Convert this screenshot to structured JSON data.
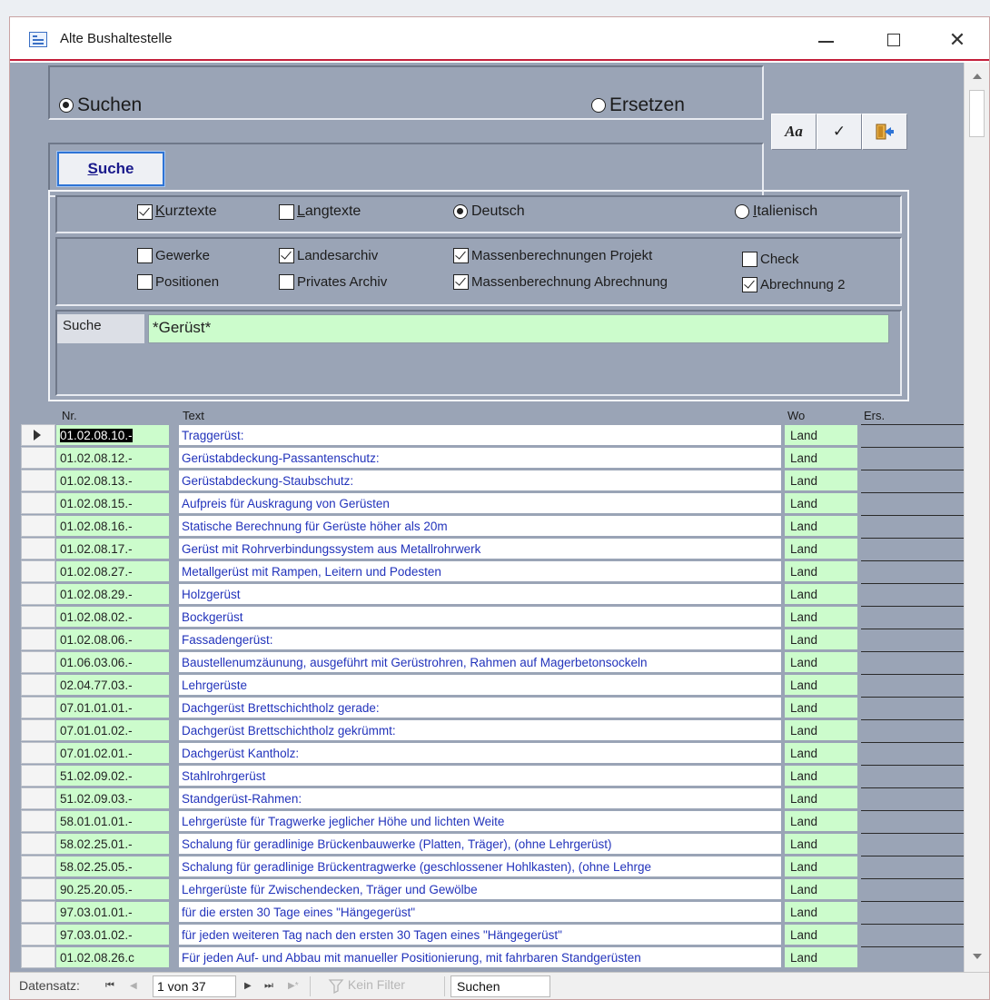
{
  "window": {
    "title": "Alte Bushaltestelle",
    "close_symbol": "✕"
  },
  "mode": {
    "search_label": "Suchen",
    "replace_label": "Ersetzen",
    "selected": "Suchen"
  },
  "toolbar": {
    "font_label": "Aa",
    "check_label": "✓"
  },
  "search_button_label": "Suche",
  "text_type": {
    "short_label": "Kurztexte",
    "short_checked": true,
    "long_label": "Langtexte",
    "long_checked": false,
    "german_label": "Deutsch",
    "italian_label": "Italienisch",
    "language_selected": "Deutsch"
  },
  "sources": {
    "gewerke": "Gewerke",
    "positionen": "Positionen",
    "landesarchiv": "Landesarchiv",
    "privates_archiv": "Privates Archiv",
    "mb_projekt": "Massenberechnungen Projekt",
    "mb_abrechnung": "Massenberechnung Abrechnung",
    "check": "Check",
    "abrechnung2": "Abrechnung 2"
  },
  "search_field": {
    "label": "Suche",
    "value": "*Gerüst*"
  },
  "table": {
    "headers": {
      "nr": "Nr.",
      "text": "Text",
      "wo": "Wo",
      "ers": "Ers."
    },
    "rows": [
      {
        "nr": "01.02.08.10.-",
        "text": "Traggerüst:",
        "wo": "Land"
      },
      {
        "nr": "01.02.08.12.-",
        "text": "Gerüstabdeckung-Passantenschutz:",
        "wo": "Land"
      },
      {
        "nr": "01.02.08.13.-",
        "text": "Gerüstabdeckung-Staubschutz:",
        "wo": "Land"
      },
      {
        "nr": "01.02.08.15.-",
        "text": "Aufpreis für Auskragung von Gerüsten",
        "wo": "Land"
      },
      {
        "nr": "01.02.08.16.-",
        "text": "Statische Berechnung für Gerüste höher als 20m",
        "wo": "Land"
      },
      {
        "nr": "01.02.08.17.-",
        "text": "Gerüst mit Rohrverbindungssystem aus Metallrohrwerk",
        "wo": "Land"
      },
      {
        "nr": "01.02.08.27.-",
        "text": "Metallgerüst mit Rampen, Leitern und Podesten",
        "wo": "Land"
      },
      {
        "nr": "01.02.08.29.-",
        "text": "Holzgerüst",
        "wo": "Land"
      },
      {
        "nr": "01.02.08.02.-",
        "text": "Bockgerüst",
        "wo": "Land"
      },
      {
        "nr": "01.02.08.06.-",
        "text": "Fassadengerüst:",
        "wo": "Land"
      },
      {
        "nr": "01.06.03.06.-",
        "text": "Baustellenumzäunung, ausgeführt mit Gerüstrohren, Rahmen auf Magerbetonsockeln",
        "wo": "Land"
      },
      {
        "nr": "02.04.77.03.-",
        "text": "Lehrgerüste",
        "wo": "Land"
      },
      {
        "nr": "07.01.01.01.-",
        "text": "Dachgerüst Brettschichtholz gerade:",
        "wo": "Land"
      },
      {
        "nr": "07.01.01.02.-",
        "text": "Dachgerüst Brettschichtholz gekrümmt:",
        "wo": "Land"
      },
      {
        "nr": "07.01.02.01.-",
        "text": "Dachgerüst Kantholz:",
        "wo": "Land"
      },
      {
        "nr": "51.02.09.02.-",
        "text": "Stahlrohrgerüst",
        "wo": "Land"
      },
      {
        "nr": "51.02.09.03.-",
        "text": "Standgerüst-Rahmen:",
        "wo": "Land"
      },
      {
        "nr": "58.01.01.01.-",
        "text": "Lehrgerüste für Tragwerke jeglicher Höhe und lichten Weite",
        "wo": "Land"
      },
      {
        "nr": "58.02.25.01.-",
        "text": "Schalung für geradlinige Brückenbauwerke (Platten, Träger), (ohne Lehrgerüst)",
        "wo": "Land"
      },
      {
        "nr": "58.02.25.05.-",
        "text": "Schalung für geradlinige Brückentragwerke (geschlossener Hohlkasten), (ohne Lehrge",
        "wo": "Land"
      },
      {
        "nr": "90.25.20.05.-",
        "text": "Lehrgerüste für Zwischendecken, Träger und Gewölbe",
        "wo": "Land"
      },
      {
        "nr": "97.03.01.01.-",
        "text": "für die ersten 30 Tage eines \"Hängegerüst\"",
        "wo": "Land"
      },
      {
        "nr": "97.03.01.02.-",
        "text": "für jeden weiteren Tag nach den ersten 30 Tagen eines  \"Hängegerüst\"",
        "wo": "Land"
      },
      {
        "nr": "01.02.08.26.c",
        "text": "Für jeden Auf- und Abbau mit manueller Positionierung, mit fahrbaren Standgerüsten",
        "wo": "Land"
      }
    ]
  },
  "navigation": {
    "record_label": "Datensatz:",
    "first": "⏮",
    "prev": "◀",
    "position": "1 von 37",
    "next": "▶",
    "last": "⏭",
    "new": "▶*",
    "filter_label": "Kein Filter",
    "search_value": "Suchen"
  }
}
